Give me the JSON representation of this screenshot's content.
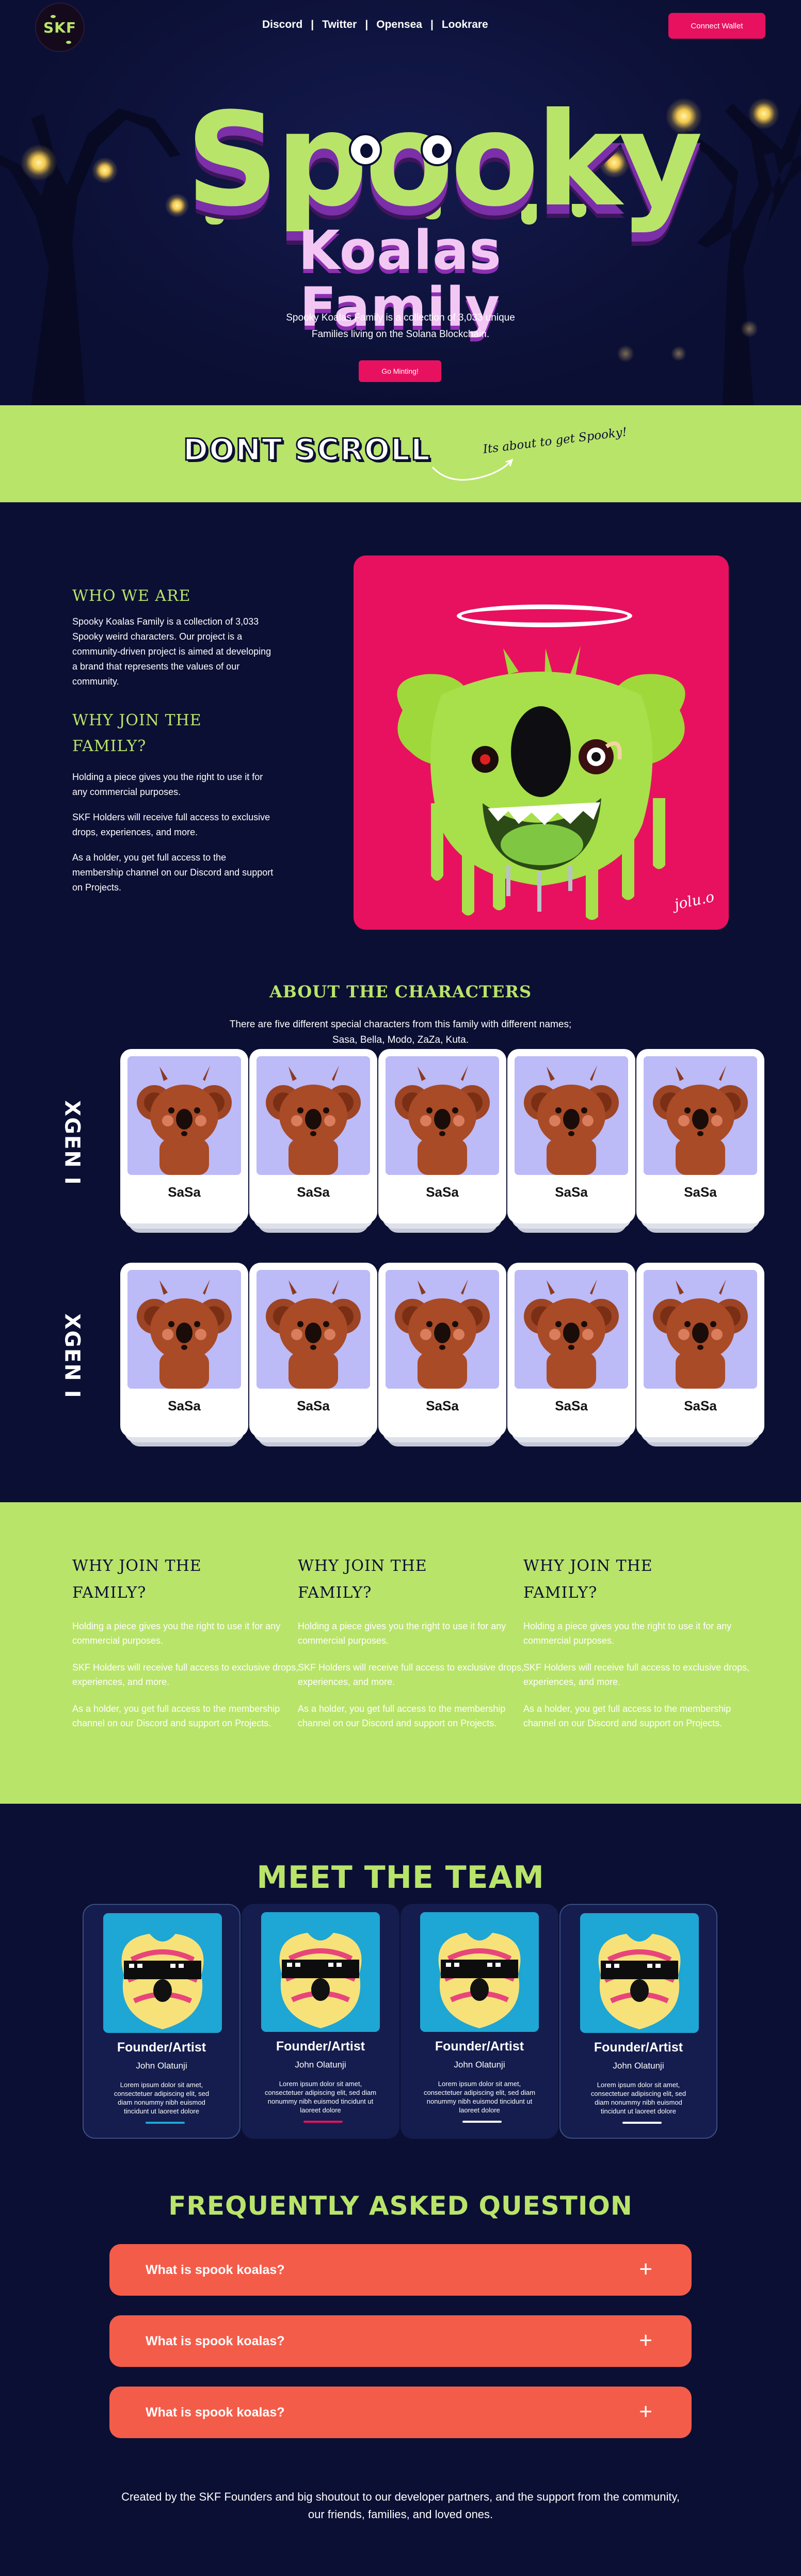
{
  "header": {
    "logo_text": "SKF",
    "nav": [
      "Discord",
      "Twitter",
      "Opensea",
      "Lookrare"
    ],
    "nav_separator": "|",
    "connect_label": "Connect Wallet"
  },
  "hero": {
    "title_main": "Spooky",
    "title_sub": "Koalas Family",
    "description": "Spooky Koalas Family is a collection of 3,033 unique Families living on the Solana Blockchain.",
    "cta_label": "Go Minting!"
  },
  "banner": {
    "headline": "DONT SCROLL",
    "note": "Its about to get Spooky!"
  },
  "about": {
    "who_title": "WHO WE ARE",
    "who_text": "Spooky Koalas Family is a collection of 3,033 Spooky weird characters. Our project is a community-driven project is aimed at developing a brand that represents the values of our community.",
    "why_title": "WHY JOIN THE FAMILY?",
    "why_points": [
      "Holding a piece gives you the right to use it for any commercial purposes.",
      "SKF Holders will receive full access to exclusive drops, experiences, and more.",
      "As a holder, you get full access to the membership channel on our Discord and support on Projects."
    ],
    "art_signature": "jolu.o"
  },
  "characters": {
    "title": "ABOUT THE CHARACTERS",
    "subtitle": "There are five different special characters from this family with different names; Sasa, Bella, Modo, ZaZa, Kuta.",
    "rows": [
      {
        "label": "XGEN I",
        "cards": [
          "SaSa",
          "SaSa",
          "SaSa",
          "SaSa",
          "SaSa"
        ]
      },
      {
        "label": "XGEN I",
        "cards": [
          "SaSa",
          "SaSa",
          "SaSa",
          "SaSa",
          "SaSa"
        ]
      }
    ]
  },
  "why_columns": [
    {
      "title": "WHY JOIN THE FAMILY?",
      "points": [
        "Holding a piece gives you the right to use it for any commercial purposes.",
        "SKF Holders will receive full access to exclusive drops, experiences, and more.",
        "As a holder, you get full access to the membership channel on our Discord and support on Projects."
      ]
    },
    {
      "title": "WHY JOIN THE FAMILY?",
      "points": [
        "Holding a piece gives you the right to use it for any commercial purposes.",
        "SKF Holders will receive full access to exclusive drops, experiences, and more.",
        "As a holder, you get full access to the membership channel on our Discord and support on Projects."
      ]
    },
    {
      "title": "WHY JOIN THE FAMILY?",
      "points": [
        "Holding a piece gives you the right to use it for any commercial purposes.",
        "SKF Holders will receive full access to exclusive drops, experiences, and more.",
        "As a holder, you get full access to the membership channel on our Discord and support on Projects."
      ]
    }
  ],
  "team": {
    "title": "MEET THE TEAM",
    "members": [
      {
        "role": "Founder/Artist",
        "name": "John Olatunji",
        "bio": "Lorem ipsum dolor sit amet, consectetuer adipiscing elit, sed diam nonummy nibh euismod tincidunt ut laoreet dolore",
        "accent": "#1ea6d4"
      },
      {
        "role": "Founder/Artist",
        "name": "John Olatunji",
        "bio": "Lorem ipsum dolor sit amet, consectetuer adipiscing elit, sed diam nonummy nibh euismod tincidunt ut laoreet dolore",
        "accent": "#e8115f"
      },
      {
        "role": "Founder/Artist",
        "name": "John Olatunji",
        "bio": "Lorem ipsum dolor sit amet, consectetuer adipiscing elit, sed diam nonummy nibh euismod tincidunt ut laoreet dolore",
        "accent": "#ffffff"
      },
      {
        "role": "Founder/Artist",
        "name": "John Olatunji",
        "bio": "Lorem ipsum dolor sit amet, consectetuer adipiscing elit, sed diam nonummy nibh euismod tincidunt ut laoreet dolore",
        "accent": "#ffffff"
      }
    ]
  },
  "faq": {
    "title": "FREQUENTLY ASKED QUESTION",
    "items": [
      {
        "question": "What is spook koalas?",
        "icon": "plus-icon"
      },
      {
        "question": "What is spook koalas?",
        "icon": "plus-icon"
      },
      {
        "question": "What is spook koalas?",
        "icon": "plus-icon"
      }
    ]
  },
  "footer": {
    "text": "Created by the SKF Founders and big shoutout to our developer partners, and the support from the community, our friends, families, and loved ones."
  },
  "colors": {
    "background": "#0b0f33",
    "lime": "#b9e46a",
    "pink": "#e8115f",
    "coral": "#f45c4a",
    "lavender": "#bcbaf7"
  }
}
